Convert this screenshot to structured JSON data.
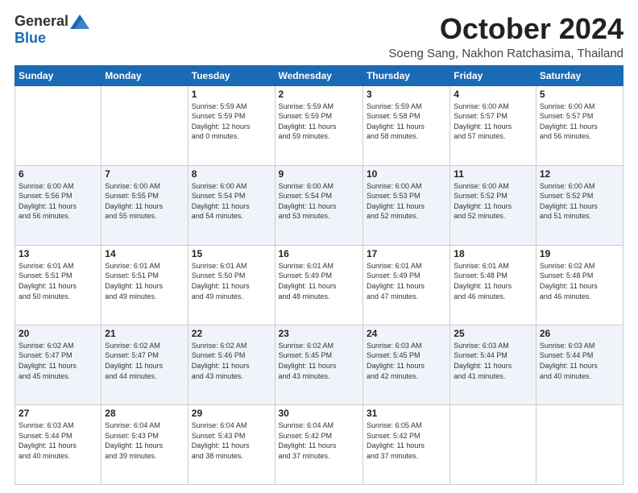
{
  "logo": {
    "general": "General",
    "blue": "Blue"
  },
  "title": {
    "month": "October 2024",
    "location": "Soeng Sang, Nakhon Ratchasima, Thailand"
  },
  "headers": [
    "Sunday",
    "Monday",
    "Tuesday",
    "Wednesday",
    "Thursday",
    "Friday",
    "Saturday"
  ],
  "weeks": [
    [
      {
        "day": "",
        "info": ""
      },
      {
        "day": "",
        "info": ""
      },
      {
        "day": "1",
        "info": "Sunrise: 5:59 AM\nSunset: 5:59 PM\nDaylight: 12 hours\nand 0 minutes."
      },
      {
        "day": "2",
        "info": "Sunrise: 5:59 AM\nSunset: 5:59 PM\nDaylight: 11 hours\nand 59 minutes."
      },
      {
        "day": "3",
        "info": "Sunrise: 5:59 AM\nSunset: 5:58 PM\nDaylight: 11 hours\nand 58 minutes."
      },
      {
        "day": "4",
        "info": "Sunrise: 6:00 AM\nSunset: 5:57 PM\nDaylight: 11 hours\nand 57 minutes."
      },
      {
        "day": "5",
        "info": "Sunrise: 6:00 AM\nSunset: 5:57 PM\nDaylight: 11 hours\nand 56 minutes."
      }
    ],
    [
      {
        "day": "6",
        "info": "Sunrise: 6:00 AM\nSunset: 5:56 PM\nDaylight: 11 hours\nand 56 minutes."
      },
      {
        "day": "7",
        "info": "Sunrise: 6:00 AM\nSunset: 5:55 PM\nDaylight: 11 hours\nand 55 minutes."
      },
      {
        "day": "8",
        "info": "Sunrise: 6:00 AM\nSunset: 5:54 PM\nDaylight: 11 hours\nand 54 minutes."
      },
      {
        "day": "9",
        "info": "Sunrise: 6:00 AM\nSunset: 5:54 PM\nDaylight: 11 hours\nand 53 minutes."
      },
      {
        "day": "10",
        "info": "Sunrise: 6:00 AM\nSunset: 5:53 PM\nDaylight: 11 hours\nand 52 minutes."
      },
      {
        "day": "11",
        "info": "Sunrise: 6:00 AM\nSunset: 5:52 PM\nDaylight: 11 hours\nand 52 minutes."
      },
      {
        "day": "12",
        "info": "Sunrise: 6:00 AM\nSunset: 5:52 PM\nDaylight: 11 hours\nand 51 minutes."
      }
    ],
    [
      {
        "day": "13",
        "info": "Sunrise: 6:01 AM\nSunset: 5:51 PM\nDaylight: 11 hours\nand 50 minutes."
      },
      {
        "day": "14",
        "info": "Sunrise: 6:01 AM\nSunset: 5:51 PM\nDaylight: 11 hours\nand 49 minutes."
      },
      {
        "day": "15",
        "info": "Sunrise: 6:01 AM\nSunset: 5:50 PM\nDaylight: 11 hours\nand 49 minutes."
      },
      {
        "day": "16",
        "info": "Sunrise: 6:01 AM\nSunset: 5:49 PM\nDaylight: 11 hours\nand 48 minutes."
      },
      {
        "day": "17",
        "info": "Sunrise: 6:01 AM\nSunset: 5:49 PM\nDaylight: 11 hours\nand 47 minutes."
      },
      {
        "day": "18",
        "info": "Sunrise: 6:01 AM\nSunset: 5:48 PM\nDaylight: 11 hours\nand 46 minutes."
      },
      {
        "day": "19",
        "info": "Sunrise: 6:02 AM\nSunset: 5:48 PM\nDaylight: 11 hours\nand 46 minutes."
      }
    ],
    [
      {
        "day": "20",
        "info": "Sunrise: 6:02 AM\nSunset: 5:47 PM\nDaylight: 11 hours\nand 45 minutes."
      },
      {
        "day": "21",
        "info": "Sunrise: 6:02 AM\nSunset: 5:47 PM\nDaylight: 11 hours\nand 44 minutes."
      },
      {
        "day": "22",
        "info": "Sunrise: 6:02 AM\nSunset: 5:46 PM\nDaylight: 11 hours\nand 43 minutes."
      },
      {
        "day": "23",
        "info": "Sunrise: 6:02 AM\nSunset: 5:45 PM\nDaylight: 11 hours\nand 43 minutes."
      },
      {
        "day": "24",
        "info": "Sunrise: 6:03 AM\nSunset: 5:45 PM\nDaylight: 11 hours\nand 42 minutes."
      },
      {
        "day": "25",
        "info": "Sunrise: 6:03 AM\nSunset: 5:44 PM\nDaylight: 11 hours\nand 41 minutes."
      },
      {
        "day": "26",
        "info": "Sunrise: 6:03 AM\nSunset: 5:44 PM\nDaylight: 11 hours\nand 40 minutes."
      }
    ],
    [
      {
        "day": "27",
        "info": "Sunrise: 6:03 AM\nSunset: 5:44 PM\nDaylight: 11 hours\nand 40 minutes."
      },
      {
        "day": "28",
        "info": "Sunrise: 6:04 AM\nSunset: 5:43 PM\nDaylight: 11 hours\nand 39 minutes."
      },
      {
        "day": "29",
        "info": "Sunrise: 6:04 AM\nSunset: 5:43 PM\nDaylight: 11 hours\nand 38 minutes."
      },
      {
        "day": "30",
        "info": "Sunrise: 6:04 AM\nSunset: 5:42 PM\nDaylight: 11 hours\nand 37 minutes."
      },
      {
        "day": "31",
        "info": "Sunrise: 6:05 AM\nSunset: 5:42 PM\nDaylight: 11 hours\nand 37 minutes."
      },
      {
        "day": "",
        "info": ""
      },
      {
        "day": "",
        "info": ""
      }
    ]
  ]
}
